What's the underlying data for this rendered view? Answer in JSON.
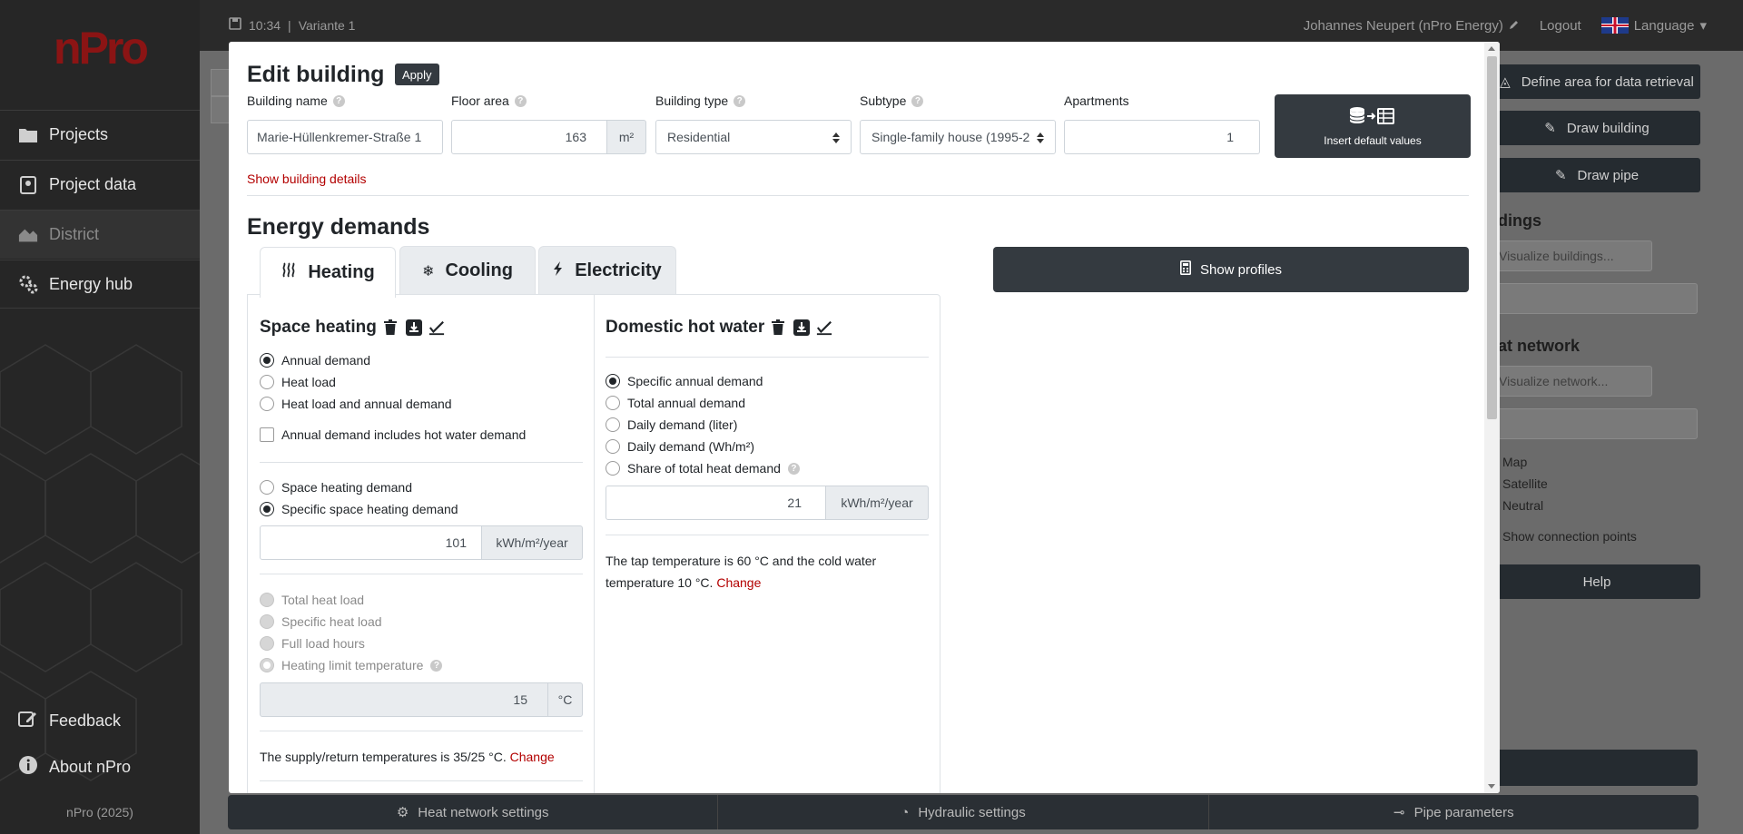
{
  "sidebar": {
    "logo": "nPro",
    "items": [
      {
        "label": "Projects"
      },
      {
        "label": "Project data"
      },
      {
        "label": "District"
      },
      {
        "label": "Energy hub"
      }
    ],
    "bottom": [
      {
        "label": "Feedback"
      },
      {
        "label": "About nPro"
      }
    ],
    "copyright": "nPro (2025)"
  },
  "topbar": {
    "time": "10:34",
    "separator": "|",
    "variant": "Variante 1",
    "user": "Johannes Neupert (nPro Energy)",
    "logout": "Logout",
    "language": "Language"
  },
  "rightpanel": {
    "define_area": "Define area for data retrieval",
    "draw_building": "Draw building",
    "draw_pipe": "Draw pipe",
    "buildings_label": "ildings",
    "visualize_buildings": "Visualize buildings...",
    "heat_network_label": "eat network",
    "visualize_network": "Visualize network...",
    "map": "Map",
    "satellite": "Satellite",
    "neutral": "Neutral",
    "connection_points": "Show connection points",
    "help": "Help"
  },
  "bottombar": {
    "heat_network_settings": "Heat network settings",
    "hydraulic_settings": "Hydraulic settings",
    "pipe_parameters": "Pipe parameters"
  },
  "modal": {
    "title": "Edit building",
    "apply": "Apply",
    "fields": {
      "building_name": {
        "label": "Building name",
        "value": "Marie-Hüllenkremer-Straße 1"
      },
      "floor_area": {
        "label": "Floor area",
        "value": "163",
        "unit": "m²"
      },
      "building_type": {
        "label": "Building type",
        "value": "Residential"
      },
      "subtype": {
        "label": "Subtype",
        "value": "Single-family house (1995-2"
      },
      "apartments": {
        "label": "Apartments",
        "value": "1"
      }
    },
    "insert_default": "Insert default values",
    "show_details": "Show building details",
    "energy_demands": "Energy demands",
    "tabs": [
      {
        "label": "Heating"
      },
      {
        "label": "Cooling"
      },
      {
        "label": "Electricity"
      }
    ],
    "show_profiles": "Show profiles",
    "space_heating": {
      "title": "Space heating",
      "options1": [
        "Annual demand",
        "Heat load",
        "Heat load and annual demand"
      ],
      "checkbox": "Annual demand includes hot water demand",
      "options2": [
        "Space heating demand",
        "Specific space heating demand"
      ],
      "specific_value": "101",
      "specific_unit": "kWh/m²/year",
      "options3": [
        "Total heat load",
        "Specific heat load",
        "Full load hours",
        "Heating limit temperature"
      ],
      "limit_value": "15",
      "limit_unit": "°C",
      "supply_text": "The supply/return temperatures is 35/25 °C.",
      "change": "Change"
    },
    "dhw": {
      "title": "Domestic hot water",
      "options": [
        "Specific annual demand",
        "Total annual demand",
        "Daily demand (liter)",
        "Daily demand (Wh/m²)",
        "Share of total heat demand"
      ],
      "value": "21",
      "unit": "kWh/m²/year",
      "tap_text_1": "The tap temperature is 60 °C and the cold water",
      "tap_text_2": "temperature 10 °C.",
      "change": "Change"
    }
  }
}
